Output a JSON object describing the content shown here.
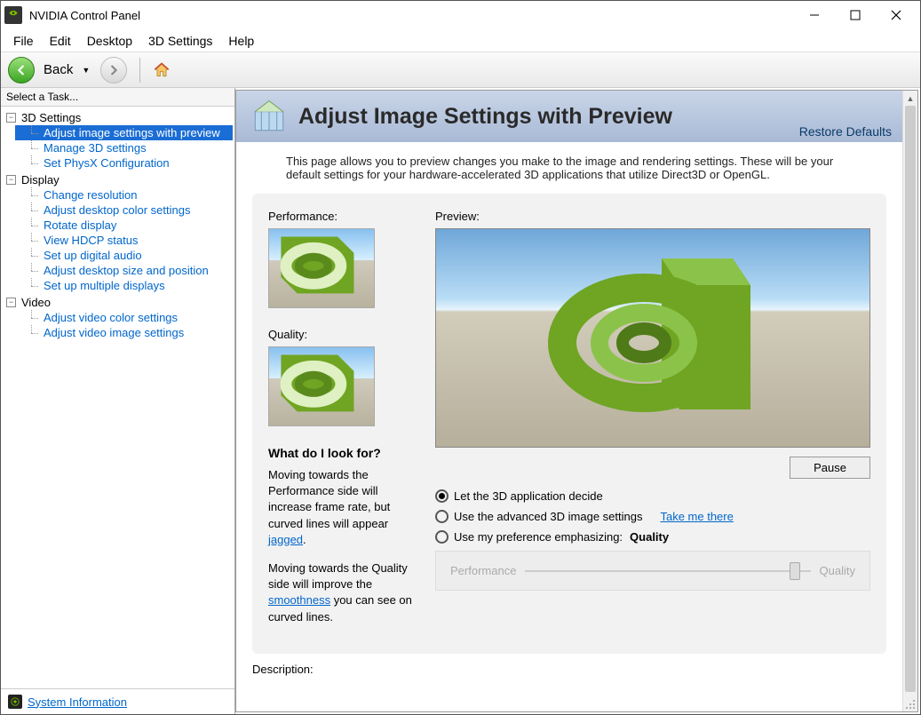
{
  "window": {
    "title": "NVIDIA Control Panel"
  },
  "menu": {
    "file": "File",
    "edit": "Edit",
    "desktop": "Desktop",
    "settings3d": "3D Settings",
    "help": "Help"
  },
  "toolbar": {
    "back": "Back"
  },
  "sidebar": {
    "header": "Select a Task...",
    "groups": [
      {
        "label": "3D Settings",
        "items": [
          "Adjust image settings with preview",
          "Manage 3D settings",
          "Set PhysX Configuration"
        ]
      },
      {
        "label": "Display",
        "items": [
          "Change resolution",
          "Adjust desktop color settings",
          "Rotate display",
          "View HDCP status",
          "Set up digital audio",
          "Adjust desktop size and position",
          "Set up multiple displays"
        ]
      },
      {
        "label": "Video",
        "items": [
          "Adjust video color settings",
          "Adjust video image settings"
        ]
      }
    ],
    "footer": "System Information"
  },
  "page": {
    "title": "Adjust Image Settings with Preview",
    "restore": "Restore Defaults",
    "description": "This page allows you to preview changes you make to the image and rendering settings. These will be your default settings for your hardware-accelerated 3D applications that utilize Direct3D or OpenGL.",
    "perf_label": "Performance:",
    "quality_label": "Quality:",
    "preview_label": "Preview:",
    "whatlook": "What do I look for?",
    "help1a": "Moving towards the Performance side will increase frame rate, but curved lines will appear ",
    "help1_link": "jagged",
    "help1b": ".",
    "help2a": "Moving towards the Quality side will improve the ",
    "help2_link": "smoothness",
    "help2b": " you can see on curved lines.",
    "pause": "Pause",
    "radio1": "Let the 3D application decide",
    "radio2": "Use the advanced 3D image settings",
    "radio2_link": "Take me there",
    "radio3": "Use my preference emphasizing:",
    "radio3_emph": "Quality",
    "slider_left": "Performance",
    "slider_right": "Quality",
    "desc_label": "Description:"
  }
}
